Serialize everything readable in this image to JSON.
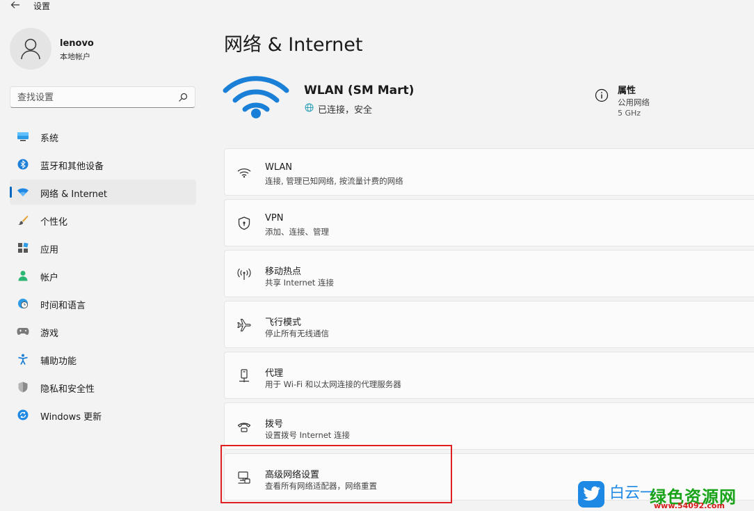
{
  "app": {
    "title": "设置"
  },
  "profile": {
    "name": "lenovo",
    "account_type": "本地帐户"
  },
  "search": {
    "placeholder": "查找设置"
  },
  "nav": {
    "items": [
      {
        "label": "系统",
        "icon": "monitor-icon"
      },
      {
        "label": "蓝牙和其他设备",
        "icon": "bluetooth-icon"
      },
      {
        "label": "网络 & Internet",
        "icon": "wifi-icon",
        "active": true
      },
      {
        "label": "个性化",
        "icon": "brush-icon"
      },
      {
        "label": "应用",
        "icon": "apps-icon"
      },
      {
        "label": "帐户",
        "icon": "person-icon"
      },
      {
        "label": "时间和语言",
        "icon": "clock-globe-icon"
      },
      {
        "label": "游戏",
        "icon": "gamepad-icon"
      },
      {
        "label": "辅助功能",
        "icon": "accessibility-icon"
      },
      {
        "label": "隐私和安全性",
        "icon": "shield-icon"
      },
      {
        "label": "Windows 更新",
        "icon": "sync-icon"
      }
    ]
  },
  "main": {
    "title": "网络 & Internet",
    "connection": {
      "name": "WLAN (SM      Mart)",
      "status": "已连接，安全"
    },
    "properties": {
      "label": "属性",
      "network_type": "公用网络",
      "band": "5 GHz"
    },
    "cards": [
      {
        "title": "WLAN",
        "subtitle": "连接, 管理已知网络, 按流量计费的网络",
        "icon": "wifi-icon"
      },
      {
        "title": "VPN",
        "subtitle": "添加、连接、管理",
        "icon": "vpn-shield-icon"
      },
      {
        "title": "移动热点",
        "subtitle": "共享 Internet 连接",
        "icon": "hotspot-icon"
      },
      {
        "title": "飞行模式",
        "subtitle": "停止所有无线通信",
        "icon": "airplane-icon"
      },
      {
        "title": "代理",
        "subtitle": "用于 Wi-Fi 和以太网连接的代理服务器",
        "icon": "proxy-icon"
      },
      {
        "title": "拨号",
        "subtitle": "设置拨号 Internet 连接",
        "icon": "dialup-icon"
      },
      {
        "title": "高级网络设置",
        "subtitle": "查看所有网络适配器，网络重置",
        "icon": "network-adapter-icon"
      }
    ]
  },
  "watermark": {
    "brand1": "白云一",
    "brand2": "绿色资源网",
    "url": "www.54092.com"
  },
  "colors": {
    "accent": "#0067c0",
    "highlight": "#e02020"
  }
}
